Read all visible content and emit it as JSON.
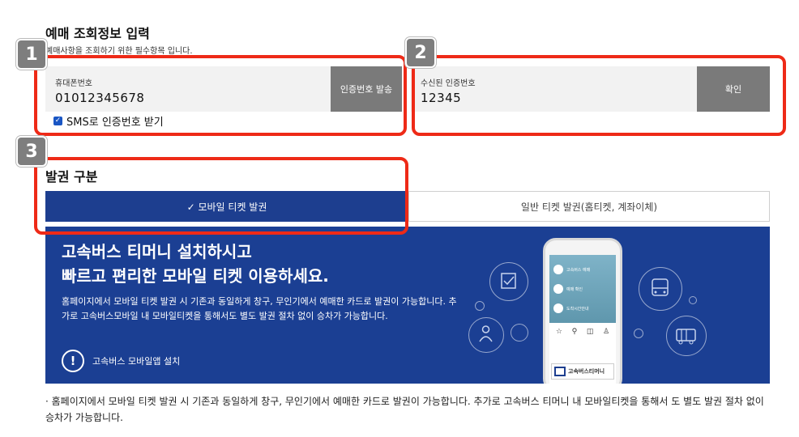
{
  "section": {
    "title": "예매 조회정보 입력",
    "subtitle": "예매사항을 조회하기 위한 필수항목 입니다."
  },
  "phone_field": {
    "label": "휴대폰번호",
    "value": "01012345678",
    "send_button": "인증번호 발송"
  },
  "sms_checkbox": {
    "checkmark": "✓",
    "label": "SMS로 인증번호 받기"
  },
  "code_field": {
    "label": "수신된 인증번호",
    "value": "12345",
    "confirm_button": "확인"
  },
  "issue": {
    "title": "발권 구분",
    "tabs": [
      {
        "label": "✓ 모바일 티켓 발권",
        "active": true
      },
      {
        "label": "일반 티켓 발권(홈티켓, 계좌이체)",
        "active": false
      }
    ]
  },
  "banner": {
    "headline_1": "고속버스 티머니 설치하시고",
    "headline_2": "빠르고 편리한 모바일 티켓 이용하세요.",
    "description": "홈페이지에서 모바일 티켓 발권 시 기존과 동일하게 창구, 무인기에서 예매한 카드로 발권이 가능합니다. 추가로 고속버스모바일 내 모바일티켓을 통해서도 별도 발권 절차 없이 승차가 가능합니다.",
    "install_icon": "!",
    "install_label": "고속버스 모바일앱 설치",
    "phone": {
      "menu_1": "고속버스 예매",
      "menu_2": "예매 확인",
      "menu_3": "도착시간안내",
      "brand": "고속버스티머니"
    },
    "bg_color": "#1b3f93"
  },
  "note": "· 홈페이지에서 모바일 티켓 발권 시 기존과 동일하게 창구, 무인기에서 예매한 카드로 발권이 가능합니다. 추가로 고속버스 티머니 내 모바일티켓을 통해서 도 별도 발권 절차 없이 승차가 가능합니다.",
  "annotations": {
    "badge_1": "1",
    "badge_2": "2",
    "badge_3": "3",
    "highlight_color": "#ee2a17"
  }
}
